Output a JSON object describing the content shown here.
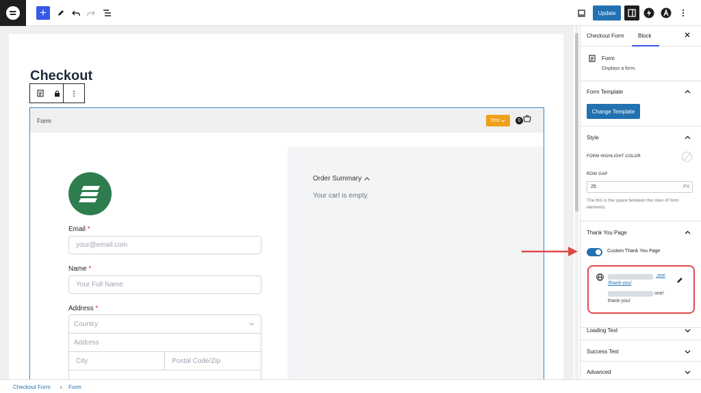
{
  "toolbar": {
    "update_label": "Update",
    "logo_icon": "surecart-logo-icon",
    "add_icon": "+"
  },
  "editor": {
    "page_title": "Checkout",
    "form_block_label": "Form",
    "test_badge": "Test",
    "cart_count": "0"
  },
  "form": {
    "email_label": "Email",
    "email_placeholder": "your@email.com",
    "name_label": "Name",
    "name_placeholder": "Your Full Name",
    "address_label": "Address",
    "country_placeholder": "Country",
    "address_placeholder": "Address",
    "city_placeholder": "City",
    "postal_placeholder": "Postal Code/Zip",
    "required_mark": "*"
  },
  "summary": {
    "title": "Order Summary",
    "empty_text": "Your cart is empty."
  },
  "sidebar": {
    "tabs": [
      "Checkout Form",
      "Block"
    ],
    "active_tab": "Block",
    "block_name": "Form",
    "block_desc": "Displays a form.",
    "form_template_heading": "Form Template",
    "change_template_label": "Change Template",
    "style_heading": "Style",
    "highlight_color_label": "FORM HIGHLIGHT COLOR",
    "row_gap_label": "ROW GAP",
    "row_gap_value": "25",
    "row_gap_unit": "PX",
    "row_gap_help": "The this is the space between the rows of form elements.",
    "thank_you_heading": "Thank You Page",
    "custom_thank_you_label": "Custom Thank You Page",
    "url_link_suffix": ".one",
    "url_link_path": "/thank-you/",
    "url_plain_suffix": "one/",
    "url_plain_path": "thank-you/",
    "loading_text_heading": "Loading Text",
    "success_text_heading": "Success Text",
    "advanced_heading": "Advanced"
  },
  "breadcrumb": {
    "items": [
      "Checkout Form",
      "Form"
    ],
    "separator": "›"
  },
  "colors": {
    "accent": "#2271b1",
    "wp_blue": "#3858e9",
    "test_badge": "#f0a01a",
    "brand_green": "#2e7d4f",
    "highlight_red": "#e04848"
  }
}
